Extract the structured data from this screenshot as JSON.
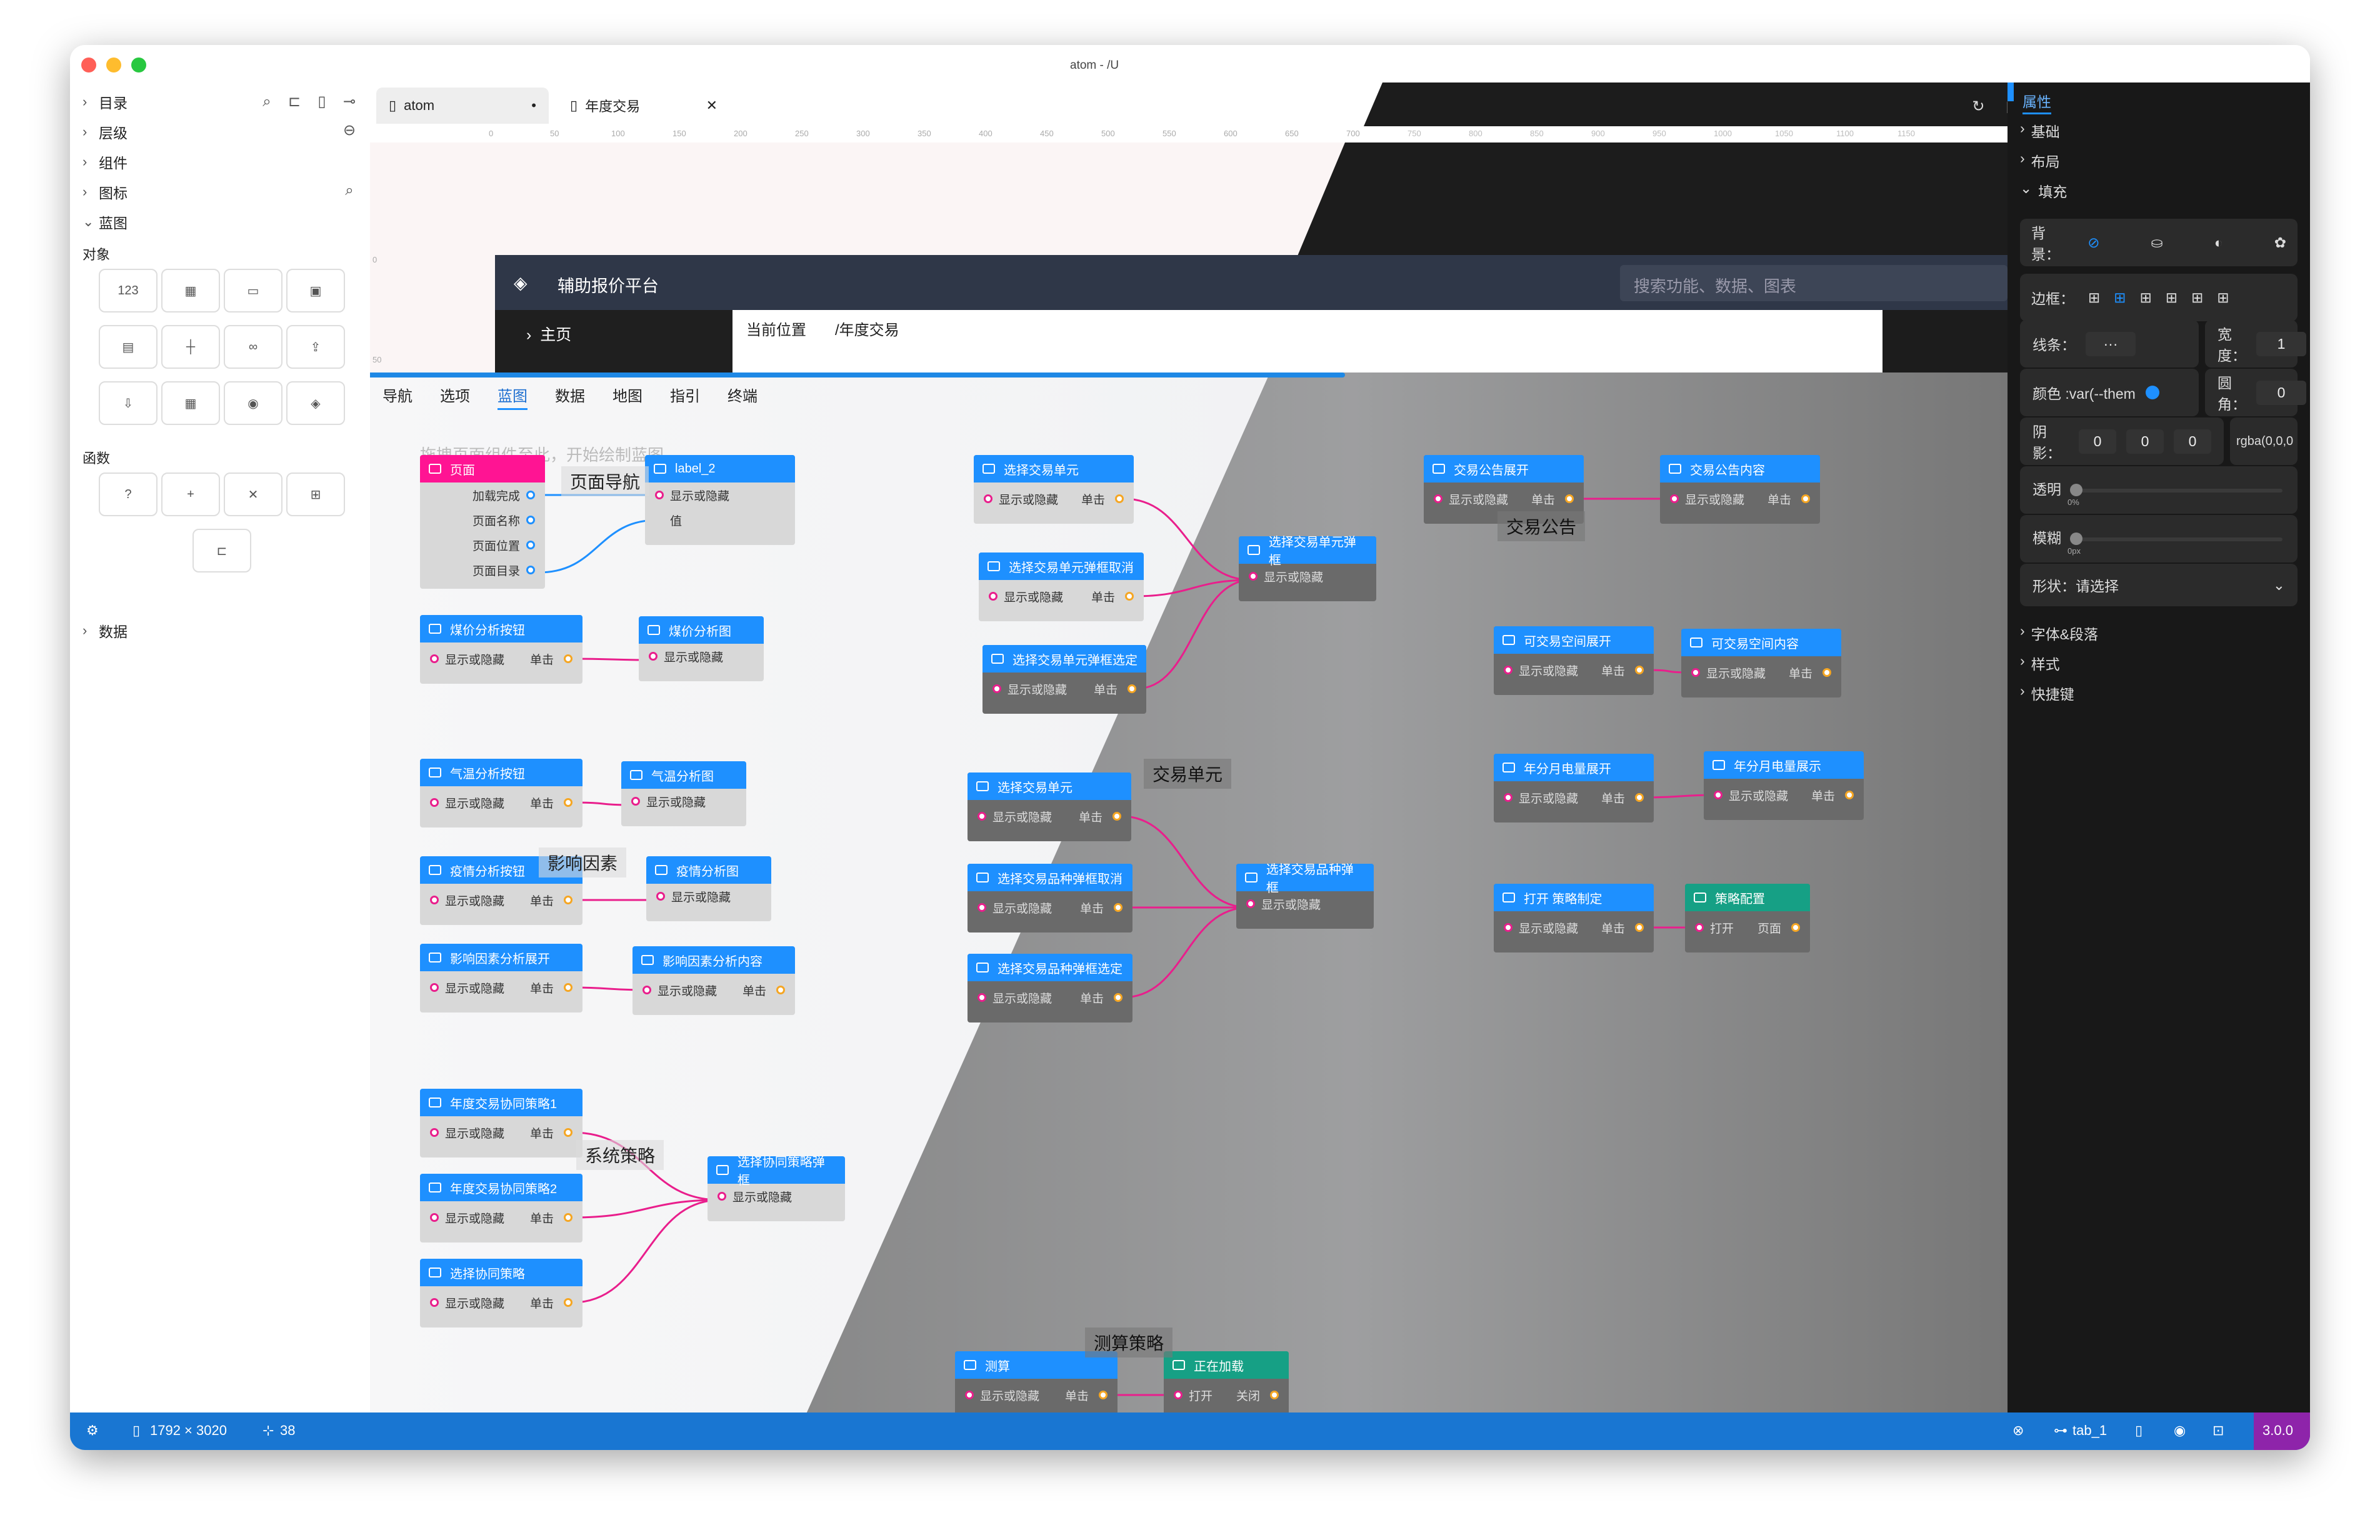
{
  "window": {
    "title": "atom - /U"
  },
  "left": {
    "tree_top": [
      "目录",
      "层级",
      "组件",
      "图标",
      "蓝图"
    ],
    "section_objects": "对象",
    "objects": [
      {
        "label": "123",
        "icon": "number-icon"
      },
      {
        "label": "▦",
        "icon": "grid-icon"
      },
      {
        "label": "▭",
        "icon": "window-icon"
      },
      {
        "label": "▣",
        "icon": "gamepad-icon"
      },
      {
        "label": "▤",
        "icon": "document-icon"
      },
      {
        "label": "┼",
        "icon": "signpost-icon"
      },
      {
        "label": "∞",
        "icon": "link-icon"
      },
      {
        "label": "⇪",
        "icon": "cloud-upload-icon"
      },
      {
        "label": "⇩",
        "icon": "cloud-download-icon"
      },
      {
        "label": "▦",
        "icon": "calendar-icon"
      },
      {
        "label": "◉",
        "icon": "chrome-icon"
      },
      {
        "label": "◈",
        "icon": "tag-icon"
      }
    ],
    "section_functions": "函数",
    "functions": [
      "?",
      "+",
      "✕",
      "⊞",
      "⊏"
    ],
    "tree_bottom": "数据"
  },
  "tabs": [
    {
      "label": "atom",
      "marker": "•"
    },
    {
      "label": "年度交易",
      "marker": "✕"
    }
  ],
  "ruler": [
    "0",
    "50",
    "100",
    "150",
    "200",
    "250",
    "300",
    "350",
    "400",
    "450",
    "500",
    "550",
    "600",
    "650",
    "700",
    "750",
    "800",
    "850",
    "900",
    "950",
    "1000",
    "1050",
    "1100",
    "1150"
  ],
  "ruler_side": [
    "0",
    "50"
  ],
  "app": {
    "title": "辅助报价平台",
    "search_placeholder": "搜索功能、数据、图表",
    "nav_item": "主页",
    "crumb_label": "当前位置",
    "crumb_value": "/年度交易"
  },
  "blueprint": {
    "tabs": [
      "导航",
      "选项",
      "蓝图",
      "数据",
      "地图",
      "指引",
      "终端"
    ],
    "active_tab": "蓝图",
    "hint": "拖拽页面组件至此，开始绘制蓝图。",
    "groups": [
      "页面导航",
      "影响因素",
      "系统策略",
      "交易单元",
      "测算策略",
      "交易公告"
    ],
    "nodes": [
      {
        "id": "page",
        "title": "页面",
        "color": "#ff1493",
        "rows": [
          "加载完成",
          "页面名称",
          "页面位置",
          "页面目录"
        ]
      },
      {
        "id": "label2",
        "title": "label_2",
        "rows": [
          "显示或隐藏",
          "值"
        ]
      },
      {
        "id": "n1",
        "title": "煤价分析按钮",
        "rows": [
          "显示或隐藏",
          "单击"
        ]
      },
      {
        "id": "n2",
        "title": "煤价分析图",
        "rows": [
          "显示或隐藏"
        ]
      },
      {
        "id": "n3",
        "title": "气温分析按钮",
        "rows": [
          "显示或隐藏",
          "单击"
        ]
      },
      {
        "id": "n4",
        "title": "气温分析图",
        "rows": [
          "显示或隐藏"
        ]
      },
      {
        "id": "n5",
        "title": "疫情分析按钮",
        "rows": [
          "显示或隐藏",
          "单击"
        ]
      },
      {
        "id": "n6",
        "title": "疫情分析图",
        "rows": [
          "显示或隐藏"
        ]
      },
      {
        "id": "n7",
        "title": "影响因素分析展开",
        "rows": [
          "显示或隐藏",
          "单击"
        ]
      },
      {
        "id": "n8",
        "title": "影响因素分析内容",
        "rows": [
          "显示或隐藏",
          "单击"
        ]
      },
      {
        "id": "n9",
        "title": "年度交易协同策略1",
        "rows": [
          "显示或隐藏",
          "单击"
        ]
      },
      {
        "id": "n10",
        "title": "年度交易协同策略2",
        "rows": [
          "显示或隐藏",
          "单击"
        ]
      },
      {
        "id": "n11",
        "title": "选择协同策略",
        "rows": [
          "显示或隐藏",
          "单击"
        ]
      },
      {
        "id": "n12",
        "title": "选择协同策略弹框",
        "rows": [
          "显示或隐藏"
        ]
      },
      {
        "id": "n13",
        "title": "选择交易单元",
        "rows": [
          "显示或隐藏",
          "单击"
        ]
      },
      {
        "id": "n14",
        "title": "选择交易单元弹框取消",
        "rows": [
          "显示或隐藏",
          "单击"
        ]
      },
      {
        "id": "n15",
        "title": "选择交易单元弹框选定",
        "rows": [
          "显示或隐藏",
          "单击"
        ]
      },
      {
        "id": "n16",
        "title": "选择交易单元弹框",
        "rows": [
          "显示或隐藏"
        ]
      },
      {
        "id": "n17",
        "title": "选择交易单元",
        "rows": [
          "显示或隐藏",
          "单击"
        ]
      },
      {
        "id": "n18",
        "title": "选择交易品种弹框取消",
        "rows": [
          "显示或隐藏",
          "单击"
        ]
      },
      {
        "id": "n19",
        "title": "选择交易品种弹框选定",
        "rows": [
          "显示或隐藏",
          "单击"
        ]
      },
      {
        "id": "n20",
        "title": "选择交易品种弹框",
        "rows": [
          "显示或隐藏"
        ]
      },
      {
        "id": "n21",
        "title": "测算",
        "rows": [
          "显示或隐藏",
          "单击"
        ]
      },
      {
        "id": "n22",
        "title": "正在加载",
        "color": "#16a085",
        "rows": [
          "打开",
          "关闭"
        ]
      },
      {
        "id": "n23",
        "title": "交易公告展开",
        "rows": [
          "显示或隐藏",
          "单击"
        ]
      },
      {
        "id": "n24",
        "title": "交易公告内容",
        "rows": [
          "显示或隐藏",
          "单击"
        ]
      },
      {
        "id": "n25",
        "title": "可交易空间展开",
        "rows": [
          "显示或隐藏",
          "单击"
        ]
      },
      {
        "id": "n26",
        "title": "可交易空间内容",
        "rows": [
          "显示或隐藏",
          "单击"
        ]
      },
      {
        "id": "n27",
        "title": "年分月电量展开",
        "rows": [
          "显示或隐藏",
          "单击"
        ]
      },
      {
        "id": "n28",
        "title": "年分月电量展示",
        "rows": [
          "显示或隐藏",
          "单击"
        ]
      },
      {
        "id": "n29",
        "title": "打开 策略制定",
        "rows": [
          "显示或隐藏",
          "单击"
        ]
      },
      {
        "id": "n30",
        "title": "策略配置",
        "color": "#16a085",
        "rows": [
          "打开",
          "页面"
        ]
      }
    ]
  },
  "right": {
    "header": "属性",
    "tree": [
      "基础",
      "布局",
      "填充"
    ],
    "bg_label": "背景：",
    "border_label": "边框：",
    "line_label": "线条：",
    "line_value": "···",
    "width_label": "宽度：",
    "width_value": "1",
    "color_label": "颜色 :var(--them",
    "radius_label": "圆角：",
    "radius_value": "0",
    "shadow_label": "阴影：",
    "shadow_values": [
      "0",
      "0",
      "0"
    ],
    "shadow_color": "rgba(0,0,0",
    "opacity_label": "透明",
    "opacity_value": "0%",
    "blur_label": "模糊",
    "blur_value": "0px",
    "shape_label": "形状：请选择",
    "tree2": [
      "字体&段落",
      "样式",
      "快捷键"
    ]
  },
  "status": {
    "size": "1792 × 3020",
    "count": "38",
    "tab": "tab_1",
    "version": "3.0.0"
  },
  "colors": {
    "accent": "#1e90ff",
    "status": "#1976d2",
    "version": "#8e24aa",
    "wire": "#e91e8c"
  }
}
